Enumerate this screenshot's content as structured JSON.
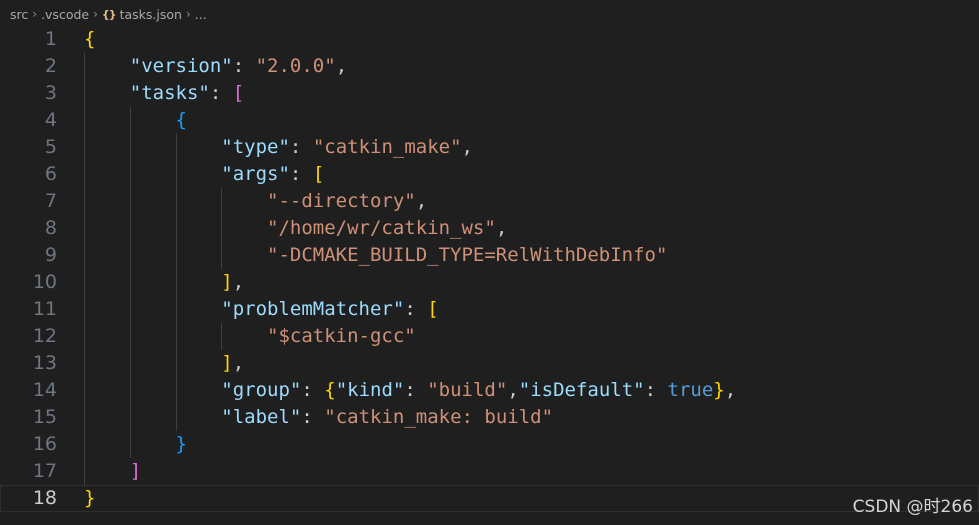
{
  "breadcrumb": {
    "items": [
      "src",
      ".vscode",
      "tasks.json",
      "..."
    ],
    "file_icon": "{}"
  },
  "editor": {
    "current_line": 18,
    "lines": [
      {
        "n": "1",
        "tokens": [
          {
            "t": "{",
            "c": "b1"
          }
        ]
      },
      {
        "n": "2",
        "tokens": [
          {
            "t": "    ",
            "c": "p"
          },
          {
            "t": "\"version\"",
            "c": "k"
          },
          {
            "t": ": ",
            "c": "p"
          },
          {
            "t": "\"2.0.0\"",
            "c": "s"
          },
          {
            "t": ",",
            "c": "p"
          }
        ]
      },
      {
        "n": "3",
        "tokens": [
          {
            "t": "    ",
            "c": "p"
          },
          {
            "t": "\"tasks\"",
            "c": "k"
          },
          {
            "t": ": ",
            "c": "p"
          },
          {
            "t": "[",
            "c": "b2"
          }
        ]
      },
      {
        "n": "4",
        "tokens": [
          {
            "t": "        ",
            "c": "p"
          },
          {
            "t": "{",
            "c": "b3"
          }
        ]
      },
      {
        "n": "5",
        "tokens": [
          {
            "t": "            ",
            "c": "p"
          },
          {
            "t": "\"type\"",
            "c": "k"
          },
          {
            "t": ": ",
            "c": "p"
          },
          {
            "t": "\"catkin_make\"",
            "c": "s"
          },
          {
            "t": ",",
            "c": "p"
          }
        ]
      },
      {
        "n": "6",
        "tokens": [
          {
            "t": "            ",
            "c": "p"
          },
          {
            "t": "\"args\"",
            "c": "k"
          },
          {
            "t": ": ",
            "c": "p"
          },
          {
            "t": "[",
            "c": "b1"
          }
        ]
      },
      {
        "n": "7",
        "tokens": [
          {
            "t": "                ",
            "c": "p"
          },
          {
            "t": "\"--directory\"",
            "c": "s"
          },
          {
            "t": ",",
            "c": "p"
          }
        ]
      },
      {
        "n": "8",
        "tokens": [
          {
            "t": "                ",
            "c": "p"
          },
          {
            "t": "\"/home/wr/catkin_ws\"",
            "c": "s"
          },
          {
            "t": ",",
            "c": "p"
          }
        ]
      },
      {
        "n": "9",
        "tokens": [
          {
            "t": "                ",
            "c": "p"
          },
          {
            "t": "\"-DCMAKE_BUILD_TYPE=RelWithDebInfo\"",
            "c": "s"
          }
        ]
      },
      {
        "n": "10",
        "tokens": [
          {
            "t": "            ",
            "c": "p"
          },
          {
            "t": "]",
            "c": "b1"
          },
          {
            "t": ",",
            "c": "p"
          }
        ]
      },
      {
        "n": "11",
        "tokens": [
          {
            "t": "            ",
            "c": "p"
          },
          {
            "t": "\"problemMatcher\"",
            "c": "k"
          },
          {
            "t": ": ",
            "c": "p"
          },
          {
            "t": "[",
            "c": "b1"
          }
        ]
      },
      {
        "n": "12",
        "tokens": [
          {
            "t": "                ",
            "c": "p"
          },
          {
            "t": "\"$catkin-gcc\"",
            "c": "s"
          }
        ]
      },
      {
        "n": "13",
        "tokens": [
          {
            "t": "            ",
            "c": "p"
          },
          {
            "t": "]",
            "c": "b1"
          },
          {
            "t": ",",
            "c": "p"
          }
        ]
      },
      {
        "n": "14",
        "tokens": [
          {
            "t": "            ",
            "c": "p"
          },
          {
            "t": "\"group\"",
            "c": "k"
          },
          {
            "t": ": ",
            "c": "p"
          },
          {
            "t": "{",
            "c": "b1"
          },
          {
            "t": "\"kind\"",
            "c": "k"
          },
          {
            "t": ": ",
            "c": "p"
          },
          {
            "t": "\"build\"",
            "c": "s"
          },
          {
            "t": ",",
            "c": "p"
          },
          {
            "t": "\"isDefault\"",
            "c": "k"
          },
          {
            "t": ": ",
            "c": "p"
          },
          {
            "t": "true",
            "c": "bool"
          },
          {
            "t": "}",
            "c": "b1"
          },
          {
            "t": ",",
            "c": "p"
          }
        ]
      },
      {
        "n": "15",
        "tokens": [
          {
            "t": "            ",
            "c": "p"
          },
          {
            "t": "\"label\"",
            "c": "k"
          },
          {
            "t": ": ",
            "c": "p"
          },
          {
            "t": "\"catkin_make: build\"",
            "c": "s"
          }
        ]
      },
      {
        "n": "16",
        "tokens": [
          {
            "t": "        ",
            "c": "p"
          },
          {
            "t": "}",
            "c": "b3"
          }
        ]
      },
      {
        "n": "17",
        "tokens": [
          {
            "t": "    ",
            "c": "p"
          },
          {
            "t": "]",
            "c": "b2"
          }
        ]
      },
      {
        "n": "18",
        "tokens": [
          {
            "t": "}",
            "c": "b1"
          }
        ]
      }
    ]
  },
  "watermark": "CSDN @时266",
  "colors": {
    "background": "#1f1f1f",
    "key": "#9cdcfe",
    "string": "#ce9178",
    "bracket_gold": "#ffd700",
    "bracket_violet": "#da70d6",
    "bracket_blue": "#179fff",
    "boolean": "#569cd6"
  }
}
